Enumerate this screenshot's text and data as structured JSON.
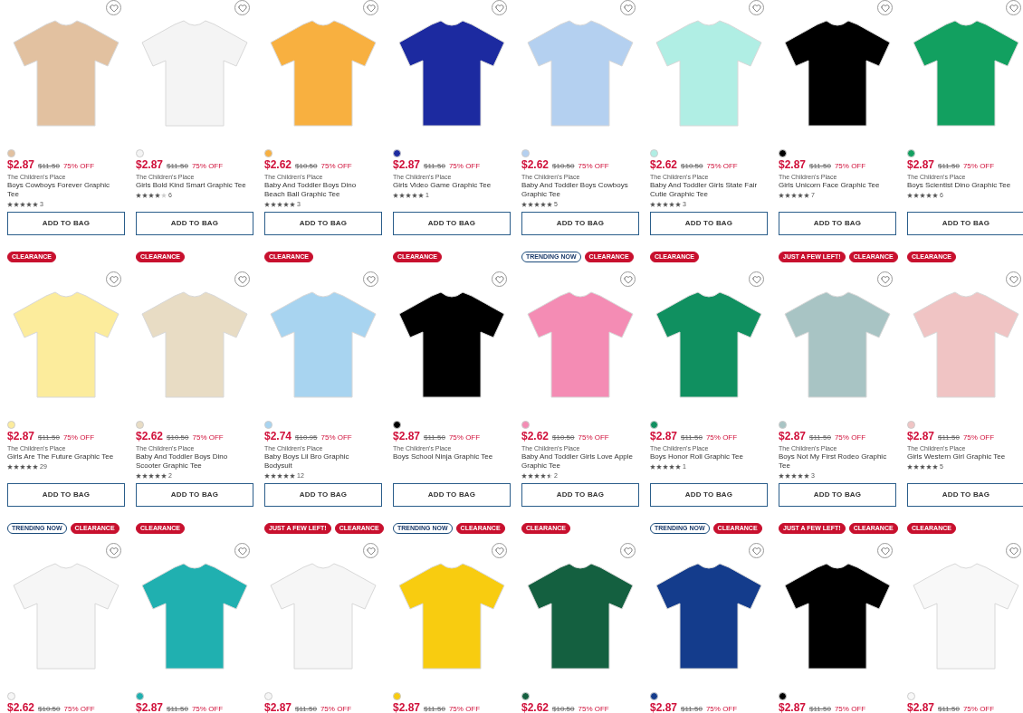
{
  "products": [
    {
      "color": "#e2c1a0",
      "price": "$2.87",
      "was": "$11.50",
      "off": "75% OFF",
      "brand": "The Children's Place",
      "name": "Boys Cowboys Forever Graphic Tee",
      "stars": 5,
      "reviews": "3",
      "button": "ADD TO BAG"
    },
    {
      "color": "#f4f4f4",
      "price": "$2.87",
      "was": "$11.50",
      "off": "75% OFF",
      "brand": "The Children's Place",
      "name": "Girls Bold Kind Smart Graphic Tee",
      "stars": 4,
      "reviews": "6",
      "button": "ADD TO BAG"
    },
    {
      "color": "#f8b040",
      "price": "$2.62",
      "was": "$10.50",
      "off": "75% OFF",
      "brand": "The Children's Place",
      "name": "Baby And Toddler Boys Dino Beach Ball Graphic Tee",
      "stars": 5,
      "reviews": "3",
      "button": "ADD TO BAG"
    },
    {
      "color": "#1c2aa0",
      "price": "$2.87",
      "was": "$11.50",
      "off": "75% OFF",
      "brand": "The Children's Place",
      "name": "Girls Video Game Graphic Tee",
      "stars": 5,
      "reviews": "1",
      "button": "ADD TO BAG"
    },
    {
      "color": "#b4d0f0",
      "price": "$2.62",
      "was": "$10.50",
      "off": "75% OFF",
      "brand": "The Children's Place",
      "name": "Baby And Toddler Boys Cowboys Graphic Tee",
      "stars": 5,
      "reviews": "5",
      "button": "ADD TO BAG"
    },
    {
      "color": "#b0eee4",
      "price": "$2.62",
      "was": "$10.50",
      "off": "75% OFF",
      "brand": "The Children's Place",
      "name": "Baby And Toddler Girls State Fair Cutie Graphic Tee",
      "stars": 5,
      "reviews": "3",
      "button": "ADD TO BAG"
    },
    {
      "color": "#000000",
      "price": "$2.87",
      "was": "$11.50",
      "off": "75% OFF",
      "brand": "The Children's Place",
      "name": "Girls Unicorn Face Graphic Tee",
      "stars": 5,
      "reviews": "7",
      "button": "ADD TO BAG"
    },
    {
      "color": "#12a060",
      "price": "$2.87",
      "was": "$11.50",
      "off": "75% OFF",
      "brand": "The Children's Place",
      "name": "Boys Scientist Dino Graphic Tee",
      "stars": 5,
      "reviews": "6",
      "button": "ADD TO BAG"
    },
    {
      "badges": [
        {
          "kind": "clearance",
          "label": "CLEARANCE"
        }
      ],
      "color": "#fcec9c",
      "price": "$2.87",
      "was": "$11.50",
      "off": "75% OFF",
      "brand": "The Children's Place",
      "name": "Girls Are The Future Graphic Tee",
      "stars": 5,
      "reviews": "29",
      "button": "ADD TO BAG"
    },
    {
      "badges": [
        {
          "kind": "clearance",
          "label": "CLEARANCE"
        }
      ],
      "color": "#e8dcc4",
      "price": "$2.62",
      "was": "$10.50",
      "off": "75% OFF",
      "brand": "The Children's Place",
      "name": "Baby And Toddler Boys Dino Scooter Graphic Tee",
      "stars": 5,
      "reviews": "2",
      "button": "ADD TO BAG"
    },
    {
      "badges": [
        {
          "kind": "clearance",
          "label": "CLEARANCE"
        }
      ],
      "color": "#a8d4f0",
      "price": "$2.74",
      "was": "$10.95",
      "off": "75% OFF",
      "brand": "The Children's Place",
      "name": "Baby Boys Lil Bro Graphic Bodysuit",
      "stars": 5,
      "reviews": "12",
      "button": "ADD TO BAG"
    },
    {
      "badges": [
        {
          "kind": "clearance",
          "label": "CLEARANCE"
        }
      ],
      "color": "#000000",
      "price": "$2.87",
      "was": "$11.50",
      "off": "75% OFF",
      "brand": "The Children's Place",
      "name": "Boys School Ninja Graphic Tee",
      "button": "ADD TO BAG"
    },
    {
      "badges": [
        {
          "kind": "trending",
          "label": "TRENDING NOW"
        },
        {
          "kind": "clearance",
          "label": "CLEARANCE"
        }
      ],
      "color": "#f48cb4",
      "price": "$2.62",
      "was": "$10.50",
      "off": "75% OFF",
      "brand": "The Children's Place",
      "name": "Baby And Toddler Girls Love Apple Graphic Tee",
      "stars": 4.5,
      "reviews": "2",
      "button": "ADD TO BAG"
    },
    {
      "badges": [
        {
          "kind": "clearance",
          "label": "CLEARANCE"
        }
      ],
      "color": "#109060",
      "price": "$2.87",
      "was": "$11.50",
      "off": "75% OFF",
      "brand": "The Children's Place",
      "name": "Boys Honor Roll Graphic Tee",
      "stars": 5,
      "reviews": "1",
      "button": "ADD TO BAG"
    },
    {
      "badges": [
        {
          "kind": "few",
          "label": "JUST A FEW LEFT!"
        },
        {
          "kind": "clearance",
          "label": "CLEARANCE"
        }
      ],
      "color": "#a8c4c4",
      "price": "$2.87",
      "was": "$11.50",
      "off": "75% OFF",
      "brand": "The Children's Place",
      "name": "Boys Not My First Rodeo Graphic Tee",
      "stars": 5,
      "reviews": "3",
      "button": "ADD TO BAG"
    },
    {
      "badges": [
        {
          "kind": "clearance",
          "label": "CLEARANCE"
        }
      ],
      "color": "#f0c4c4",
      "price": "$2.87",
      "was": "$11.50",
      "off": "75% OFF",
      "brand": "The Children's Place",
      "name": "Girls Western Girl Graphic Tee",
      "stars": 5,
      "reviews": "5",
      "button": "ADD TO BAG"
    },
    {
      "badges": [
        {
          "kind": "trending",
          "label": "TRENDING NOW"
        },
        {
          "kind": "clearance",
          "label": "CLEARANCE"
        }
      ],
      "color": "#f6f6f6",
      "price": "$2.62",
      "was": "$10.50",
      "off": "75% OFF"
    },
    {
      "badges": [
        {
          "kind": "clearance",
          "label": "CLEARANCE"
        }
      ],
      "color": "#20b0b0",
      "price": "$2.87",
      "was": "$11.50",
      "off": "75% OFF"
    },
    {
      "badges": [
        {
          "kind": "few",
          "label": "JUST A FEW LEFT!"
        },
        {
          "kind": "clearance",
          "label": "CLEARANCE"
        }
      ],
      "color": "#f6f6f6",
      "price": "$2.87",
      "was": "$11.50",
      "off": "75% OFF"
    },
    {
      "badges": [
        {
          "kind": "trending",
          "label": "TRENDING NOW"
        },
        {
          "kind": "clearance",
          "label": "CLEARANCE"
        }
      ],
      "color": "#f8cc10",
      "price": "$2.87",
      "was": "$11.50",
      "off": "75% OFF"
    },
    {
      "badges": [
        {
          "kind": "clearance",
          "label": "CLEARANCE"
        }
      ],
      "color": "#146040",
      "price": "$2.62",
      "was": "$10.50",
      "off": "75% OFF"
    },
    {
      "badges": [
        {
          "kind": "trending",
          "label": "TRENDING NOW"
        },
        {
          "kind": "clearance",
          "label": "CLEARANCE"
        }
      ],
      "color": "#143c8c",
      "price": "$2.87",
      "was": "$11.50",
      "off": "75% OFF"
    },
    {
      "badges": [
        {
          "kind": "few",
          "label": "JUST A FEW LEFT!"
        },
        {
          "kind": "clearance",
          "label": "CLEARANCE"
        }
      ],
      "color": "#000000",
      "price": "$2.87",
      "was": "$11.50",
      "off": "75% OFF"
    },
    {
      "badges": [
        {
          "kind": "clearance",
          "label": "CLEARANCE"
        }
      ],
      "color": "#f8f8f8",
      "price": "$2.87",
      "was": "$11.50",
      "off": "75% OFF"
    }
  ]
}
